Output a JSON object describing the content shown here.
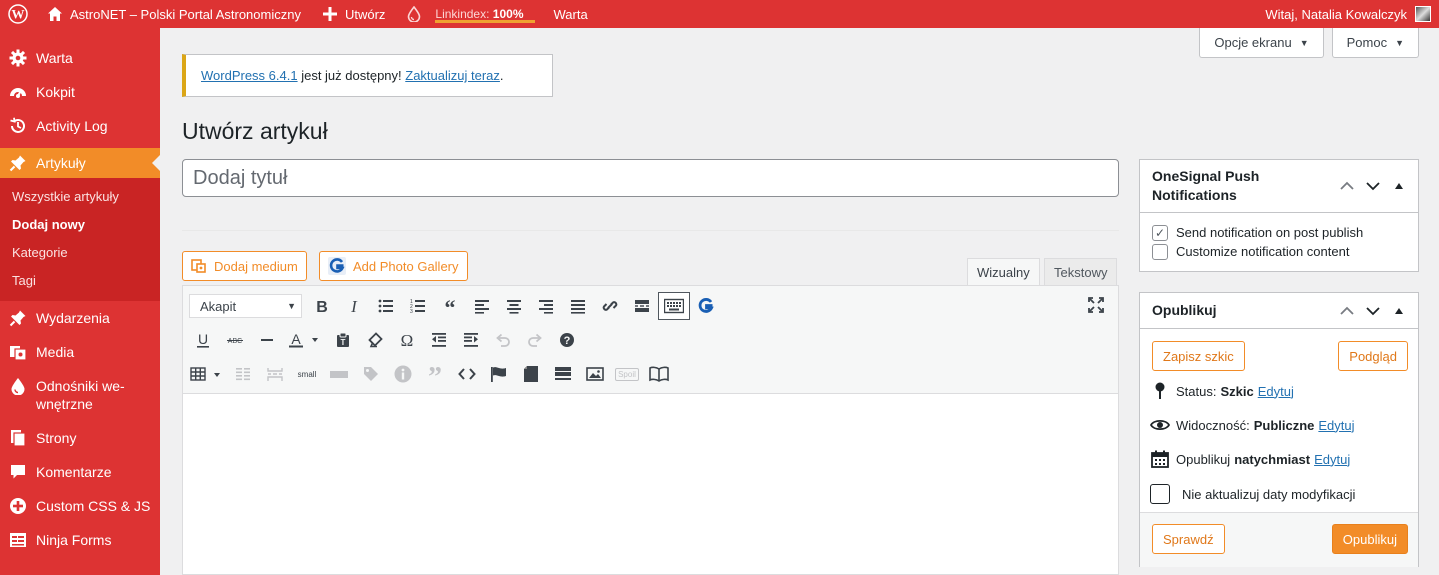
{
  "admin_bar": {
    "site_name": "AstroNET – Polski Portal Astronomiczny",
    "new_label": "Utwórz",
    "linkindex_label": "Linkindex:",
    "linkindex_value": "100%",
    "warta_label": "Warta",
    "greeting": "Witaj, Natalia Kowalczyk"
  },
  "sidebar": {
    "items": [
      {
        "label": "Warta",
        "icon": "gear-icon"
      },
      {
        "label": "Kokpit",
        "icon": "dashboard-icon"
      },
      {
        "label": "Activity Log",
        "icon": "history-icon"
      },
      {
        "label": "Artykuły",
        "icon": "pin-icon",
        "active": true
      },
      {
        "label": "Wydarzenia",
        "icon": "pin-icon"
      },
      {
        "label": "Media",
        "icon": "media-icon"
      },
      {
        "label": "Odnośniki we-wnętrzne",
        "line1": "Odnośniki we-",
        "line2": "wnętrzne",
        "icon": "drop-icon"
      },
      {
        "label": "Strony",
        "icon": "pages-icon"
      },
      {
        "label": "Komentarze",
        "icon": "comment-icon"
      },
      {
        "label": "Custom CSS & JS",
        "icon": "plus-circle-icon"
      },
      {
        "label": "Ninja Forms",
        "icon": "forms-icon"
      }
    ],
    "submenu": [
      {
        "label": "Wszystkie artykuły"
      },
      {
        "label": "Dodaj nowy",
        "current": true
      },
      {
        "label": "Kategorie"
      },
      {
        "label": "Tagi"
      }
    ]
  },
  "screen_meta": {
    "options_label": "Opcje ekranu",
    "help_label": "Pomoc"
  },
  "notice": {
    "link1": "WordPress 6.4.1",
    "middle": " jest już dostępny! ",
    "link2": "Zaktualizuj teraz",
    "end": "."
  },
  "page_title": "Utwórz artykuł",
  "title_placeholder": "Dodaj tytuł",
  "editor": {
    "add_media_label": "Dodaj medium",
    "add_gallery_label": "Add Photo Gallery",
    "tab_visual": "Wizualny",
    "tab_text": "Tekstowy",
    "format_value": "Akapit",
    "small_label": "small",
    "spoil_label": "Spoil"
  },
  "onesignal": {
    "title_line1": "OneSignal Push",
    "title_line2": "Notifications",
    "send_label": "Send notification on post publish",
    "send_checked": true,
    "customize_label": "Customize notification content",
    "customize_checked": false
  },
  "publish": {
    "title": "Opublikuj",
    "save_draft": "Zapisz szkic",
    "preview": "Podgląd",
    "status_label": "Status:",
    "status_value": "Szkic",
    "visibility_label": "Widoczność:",
    "visibility_value": "Publiczne",
    "schedule_label": "Opublikuj",
    "schedule_value": "natychmiast",
    "edit_label": "Edytuj",
    "no_update_label": "Nie aktualizuj daty modyfikacji",
    "check_label": "Sprawdź",
    "publish_label": "Opublikuj"
  },
  "colors": {
    "admin_bar": "#dd3333",
    "sidebar": "#dd3333",
    "accent": "#f28c28",
    "link": "#2271b1"
  }
}
